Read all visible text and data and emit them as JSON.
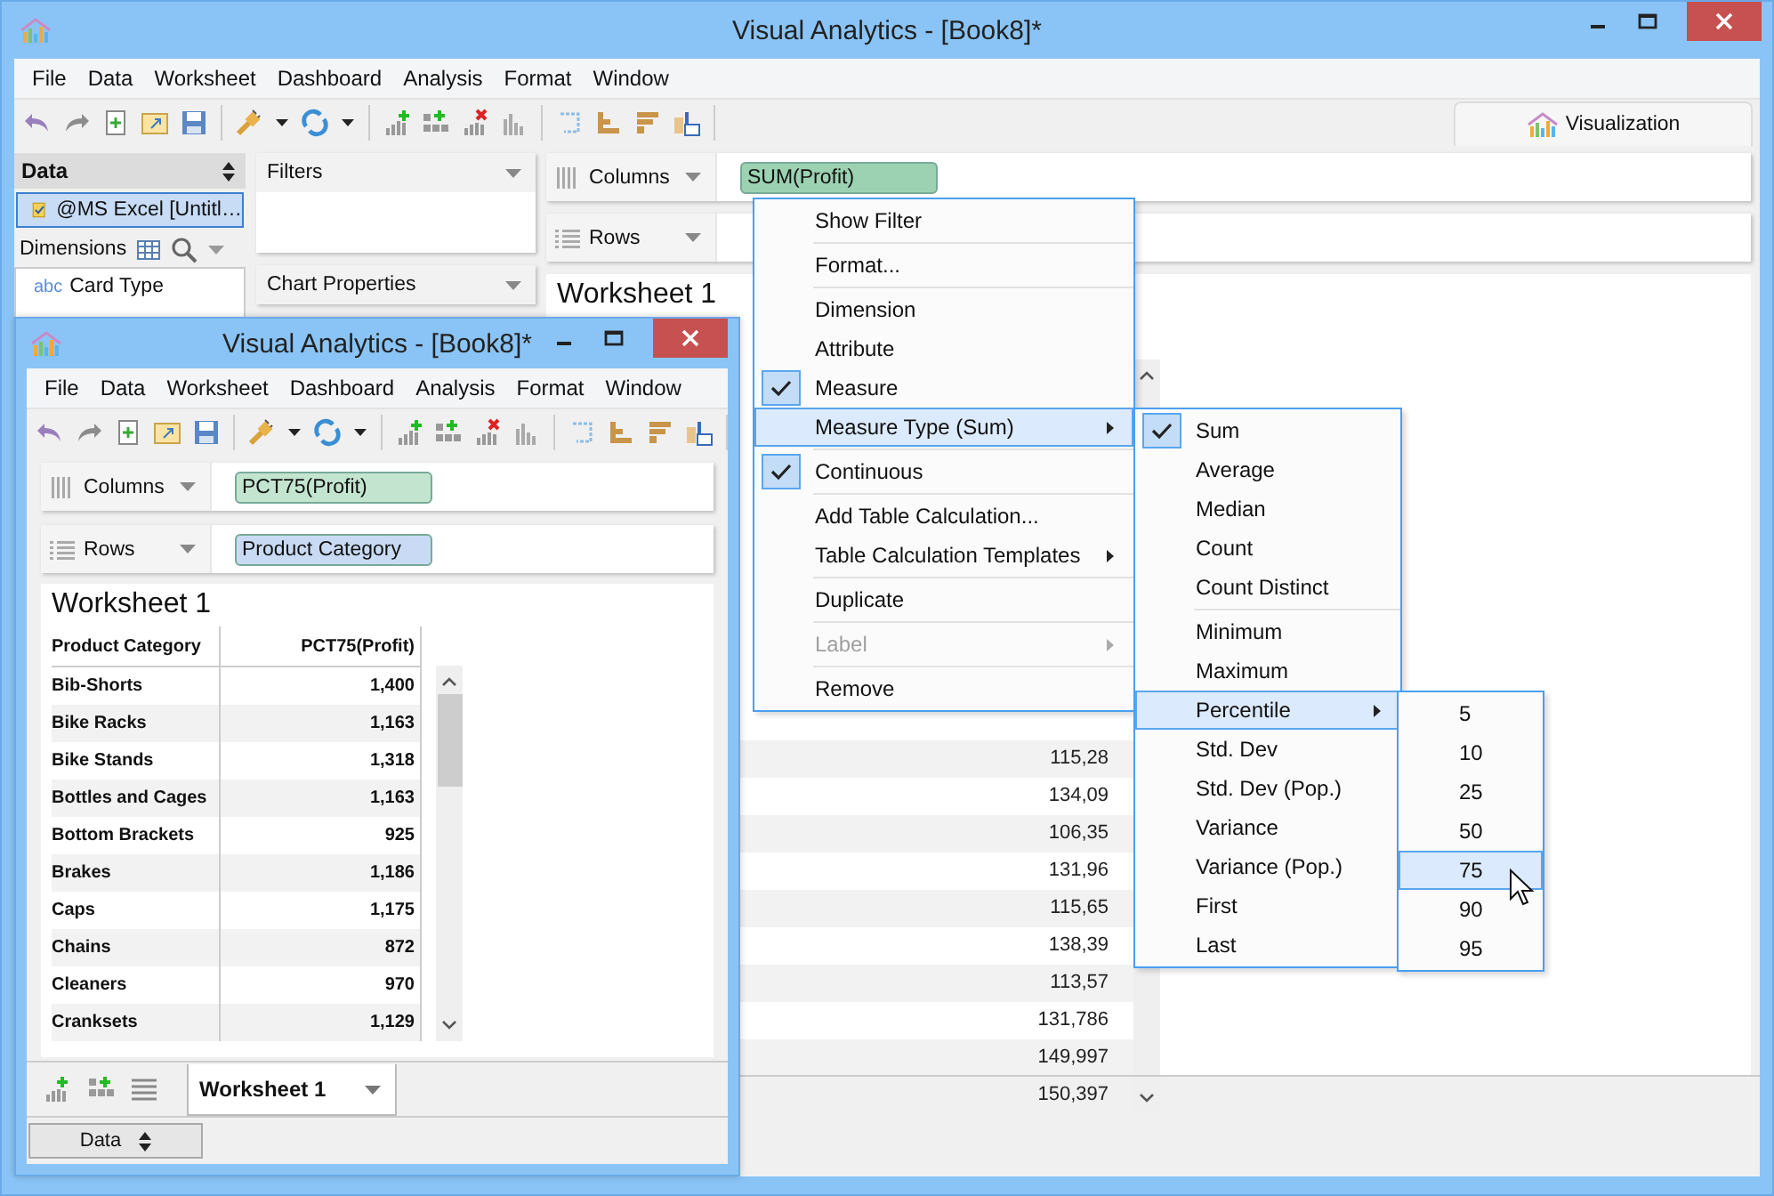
{
  "main_window": {
    "title": "Visual Analytics - [Book8]*",
    "menu": [
      "File",
      "Data",
      "Worksheet",
      "Dashboard",
      "Analysis",
      "Format",
      "Window"
    ],
    "tabs": [
      {
        "label": "Visualization",
        "selected": true
      }
    ],
    "data_panel": {
      "title": "Data",
      "sources": [
        {
          "label": "@MS Excel [Untitl…",
          "selected": true
        }
      ],
      "dimensions_label": "Dimensions",
      "fields": [
        {
          "type": "abc",
          "name": "Card Type"
        }
      ]
    },
    "filters": {
      "title": "Filters"
    },
    "chart_properties": {
      "title": "Chart Properties"
    },
    "columns_shelf": {
      "label": "Columns",
      "pills": [
        {
          "text": "SUM(Profit)",
          "kind": "measure",
          "selected": true
        }
      ]
    },
    "rows_shelf": {
      "label": "Rows"
    },
    "worksheet": {
      "title": "Worksheet 1",
      "values": [
        "115,28",
        "134,09",
        "106,35",
        "131,96",
        "115,65",
        "138,39",
        "113,57",
        "131,786",
        "149,997",
        "150,397"
      ]
    }
  },
  "inner_window": {
    "title": "Visual Analytics - [Book8]*",
    "menu": [
      "File",
      "Data",
      "Worksheet",
      "Dashboard",
      "Analysis",
      "Format",
      "Window"
    ],
    "columns_shelf": {
      "label": "Columns",
      "pills": [
        {
          "text": "PCT75(Profit)",
          "kind": "measure",
          "selected": false
        }
      ]
    },
    "rows_shelf": {
      "label": "Rows",
      "pills": [
        {
          "text": "Product Category",
          "kind": "dimension",
          "selected": false
        }
      ]
    },
    "worksheet": {
      "title": "Worksheet 1",
      "table": {
        "columns": [
          "Product Category",
          "PCT75(Profit)"
        ],
        "rows": [
          [
            "Bib-Shorts",
            "1,400"
          ],
          [
            "Bike Racks",
            "1,163"
          ],
          [
            "Bike Stands",
            "1,318"
          ],
          [
            "Bottles and Cages",
            "1,163"
          ],
          [
            "Bottom Brackets",
            "925"
          ],
          [
            "Brakes",
            "1,186"
          ],
          [
            "Caps",
            "1,175"
          ],
          [
            "Chains",
            "872"
          ],
          [
            "Cleaners",
            "970"
          ],
          [
            "Cranksets",
            "1,129"
          ]
        ]
      }
    },
    "sheet_tabs": [
      {
        "label": "Worksheet 1",
        "selected": true
      }
    ],
    "data_button": "Data"
  },
  "context_menu": {
    "sections": [
      [
        {
          "label": "Show Filter",
          "checked": false,
          "selected": false,
          "submenu": false,
          "disabled": false
        }
      ],
      [
        {
          "label": "Format...",
          "checked": false,
          "selected": false,
          "submenu": false,
          "disabled": false
        }
      ],
      [
        {
          "label": "Dimension",
          "checked": false,
          "selected": false,
          "submenu": false,
          "disabled": false
        },
        {
          "label": "Attribute",
          "checked": false,
          "selected": false,
          "submenu": false,
          "disabled": false
        },
        {
          "label": "Measure",
          "checked": true,
          "selected": false,
          "submenu": false,
          "disabled": false
        },
        {
          "label": "Measure Type (Sum)",
          "checked": false,
          "selected": true,
          "submenu": true,
          "disabled": false
        }
      ],
      [
        {
          "label": "Continuous",
          "checked": true,
          "selected": false,
          "submenu": false,
          "disabled": false
        }
      ],
      [
        {
          "label": "Add Table Calculation...",
          "checked": false,
          "selected": false,
          "submenu": false,
          "disabled": false
        },
        {
          "label": "Table Calculation Templates",
          "checked": false,
          "selected": false,
          "submenu": true,
          "disabled": false
        }
      ],
      [
        {
          "label": "Duplicate",
          "checked": false,
          "selected": false,
          "submenu": false,
          "disabled": false
        }
      ],
      [
        {
          "label": "Label",
          "checked": false,
          "selected": false,
          "submenu": true,
          "disabled": true
        }
      ],
      [
        {
          "label": "Remove",
          "checked": false,
          "selected": false,
          "submenu": false,
          "disabled": false
        }
      ]
    ]
  },
  "measure_type_menu": {
    "sections": [
      [
        {
          "label": "Sum",
          "checked": true,
          "selected": false,
          "submenu": false
        },
        {
          "label": "Average",
          "checked": false,
          "selected": false,
          "submenu": false
        },
        {
          "label": "Median",
          "checked": false,
          "selected": false,
          "submenu": false
        },
        {
          "label": "Count",
          "checked": false,
          "selected": false,
          "submenu": false
        },
        {
          "label": "Count Distinct",
          "checked": false,
          "selected": false,
          "submenu": false
        }
      ],
      [
        {
          "label": "Minimum",
          "checked": false,
          "selected": false,
          "submenu": false
        },
        {
          "label": "Maximum",
          "checked": false,
          "selected": false,
          "submenu": false
        },
        {
          "label": "Percentile",
          "checked": false,
          "selected": true,
          "submenu": true
        },
        {
          "label": "Std. Dev",
          "checked": false,
          "selected": false,
          "submenu": false
        },
        {
          "label": "Std. Dev (Pop.)",
          "checked": false,
          "selected": false,
          "submenu": false
        },
        {
          "label": "Variance",
          "checked": false,
          "selected": false,
          "submenu": false
        },
        {
          "label": "Variance (Pop.)",
          "checked": false,
          "selected": false,
          "submenu": false
        },
        {
          "label": "First",
          "checked": false,
          "selected": false,
          "submenu": false
        },
        {
          "label": "Last",
          "checked": false,
          "selected": false,
          "submenu": false
        }
      ]
    ]
  },
  "percentile_menu": {
    "sections": [
      [
        {
          "label": "5",
          "selected": false
        },
        {
          "label": "10",
          "selected": false
        },
        {
          "label": "25",
          "selected": false
        },
        {
          "label": "50",
          "selected": false
        },
        {
          "label": "75",
          "selected": true
        },
        {
          "label": "90",
          "selected": false
        },
        {
          "label": "95",
          "selected": false
        }
      ]
    ]
  }
}
